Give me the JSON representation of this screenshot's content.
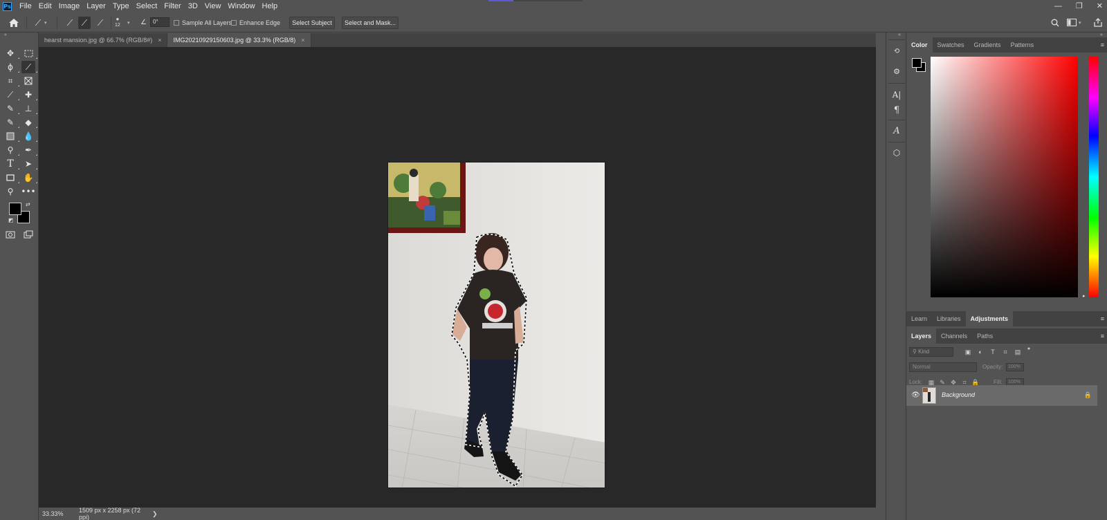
{
  "app": {
    "logo": "Ps",
    "menu": [
      "File",
      "Edit",
      "Image",
      "Layer",
      "Type",
      "Select",
      "Filter",
      "3D",
      "View",
      "Window",
      "Help"
    ],
    "window_controls": [
      "—",
      "❐",
      "✕"
    ]
  },
  "options_bar": {
    "brush_size": "12",
    "angle": "0°",
    "sample_all_layers": "Sample All Layers",
    "enhance_edge": "Enhance Edge",
    "select_subject": "Select Subject",
    "select_and_mask": "Select and Mask..."
  },
  "tabs": [
    {
      "label": "hearst mansion.jpg @ 66.7% (RGB/8#)",
      "active": false
    },
    {
      "label": "IMG20210929150603.jpg @ 33.3% (RGB/8)",
      "active": true
    }
  ],
  "status_bar": {
    "zoom": "33.33%",
    "doc_info": "1509 px x 2258 px (72 ppi)",
    "arrow": "❯"
  },
  "color_panel": {
    "tabs": [
      "Color",
      "Swatches",
      "Gradients",
      "Patterns"
    ],
    "active_tab": "Color",
    "foreground": "#000000",
    "background": "#000000"
  },
  "learn_panel": {
    "tabs": [
      "Learn",
      "Libraries",
      "Adjustments"
    ],
    "active_tab": "Adjustments"
  },
  "layers_panel": {
    "tabs": [
      "Layers",
      "Channels",
      "Paths"
    ],
    "active_tab": "Layers",
    "kind_placeholder": "Kind",
    "blend_mode": "Normal",
    "opacity_label": "Opacity:",
    "opacity_value": "100%",
    "lock_label": "Lock:",
    "fill_label": "Fill:",
    "fill_value": "100%",
    "layers": [
      {
        "name": "Background",
        "visible": true,
        "locked": true
      }
    ]
  },
  "icons": {
    "toolbar": [
      "move-icon",
      "rect-marquee-icon",
      "lasso-icon",
      "quick-selection-icon",
      "crop-icon",
      "frame-icon",
      "eyedropper-icon",
      "healing-brush-icon",
      "brush-icon",
      "clone-stamp-icon",
      "history-brush-icon",
      "eraser-icon",
      "gradient-icon",
      "blur-icon",
      "dodge-icon",
      "pen-icon",
      "type-icon",
      "path-selection-icon",
      "rectangle-icon",
      "hand-icon",
      "zoom-icon",
      "more-tools-icon"
    ]
  }
}
